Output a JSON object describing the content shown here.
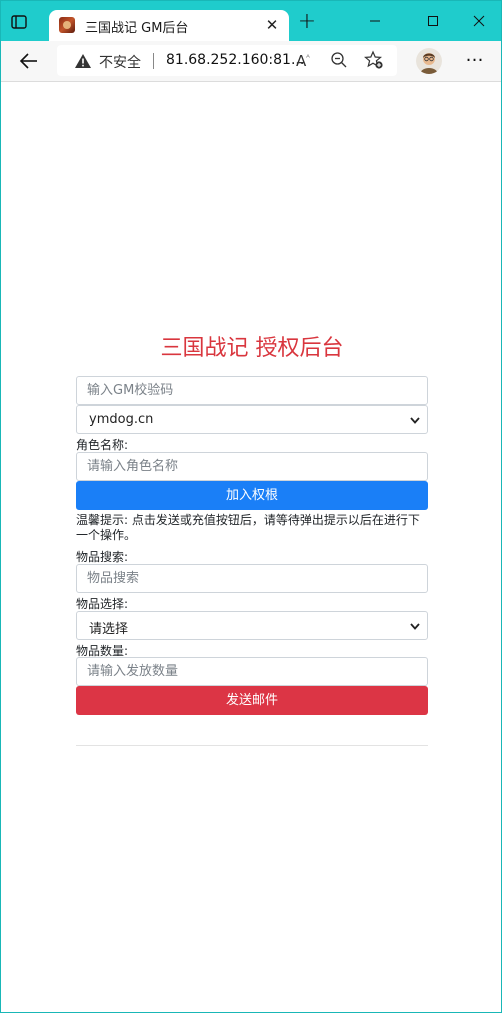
{
  "browser": {
    "tab_title": "三国战记 GM后台",
    "new_tab_symbol": "+",
    "close_symbol": "✕",
    "security_label": "不安全",
    "url": "81.68.252.160:81...",
    "read_aloud_glyph": "A"
  },
  "page": {
    "title": "三国战记 授权后台",
    "gm_code_placeholder": "输入GM校验码",
    "server_selected": "ymdog.cn",
    "role_label": "角色名称:",
    "role_placeholder": "请输入角色名称",
    "add_permission_button": "加入权根",
    "notice": "温馨提示: 点击发送或充值按钮后，请等待弹出提示以后在进行下一个操作。",
    "item_search_label": "物品搜索:",
    "item_search_placeholder": "物品搜索",
    "item_select_label": "物品选择:",
    "item_select_value": "请选择",
    "quantity_label": "物品数量:",
    "quantity_placeholder": "请输入发放数量",
    "send_mail_button": "发送邮件"
  },
  "colors": {
    "titlebar": "#1fcccc",
    "title_red": "#d9363e",
    "primary_blue": "#1a7ff7",
    "danger_red": "#dc3545"
  }
}
